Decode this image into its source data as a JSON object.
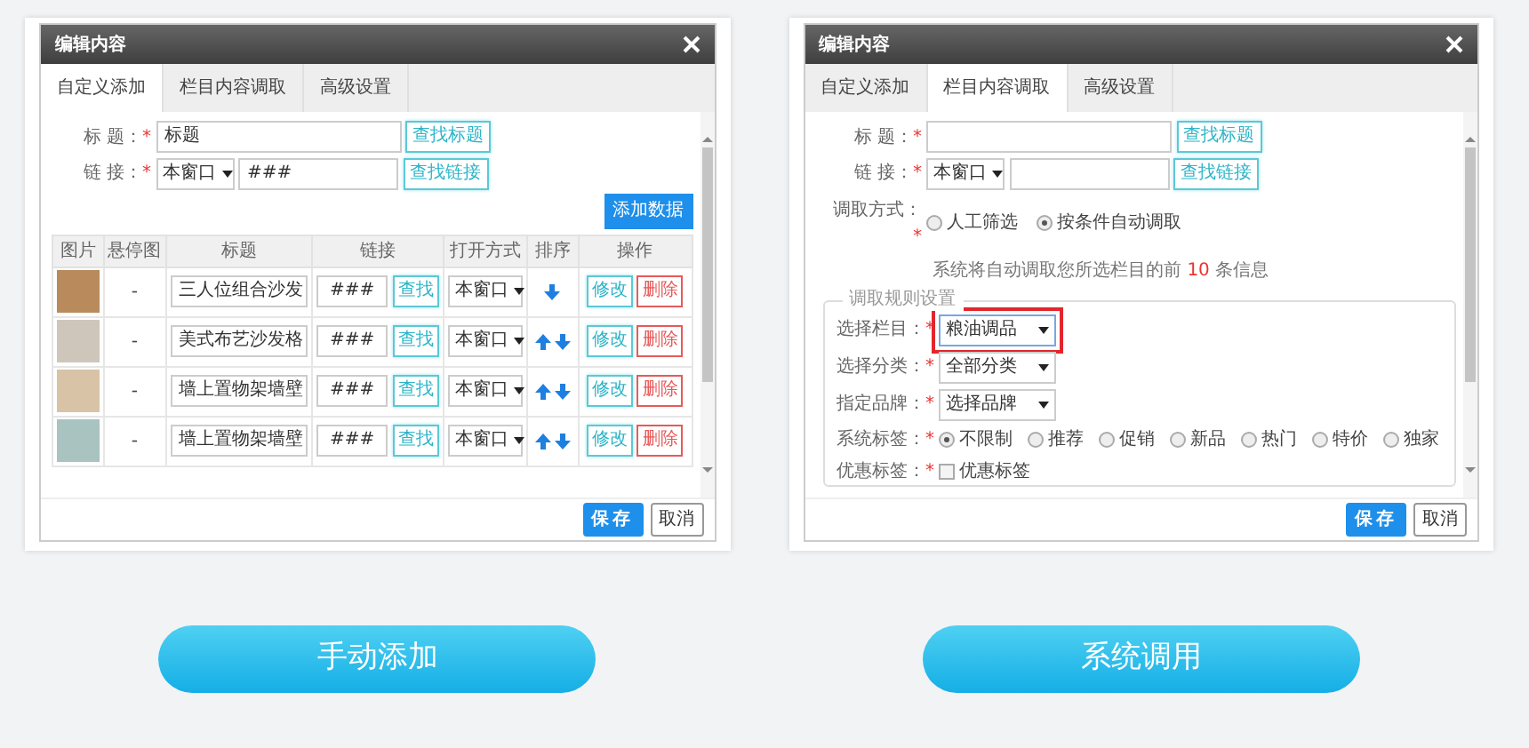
{
  "panels": [
    {
      "kind": "manual",
      "dialog": {
        "title": "编辑内容",
        "tabs": [
          {
            "label": "自定义添加",
            "selected": true
          },
          {
            "label": "栏目内容调取",
            "selected": false
          },
          {
            "label": "高级设置",
            "selected": false
          }
        ],
        "fields": [
          {
            "kind": "text",
            "label": "标 题：",
            "required": "*",
            "value": "标题",
            "button": "查找标题"
          },
          {
            "kind": "link",
            "label": "链 接：",
            "required": "*",
            "select": "本窗口",
            "value": "###",
            "button": "查找链接"
          }
        ],
        "add_button": "添加数据",
        "table": {
          "columns": [
            "图片",
            "悬停图",
            "标题",
            "链接",
            "打开方式",
            "排序",
            "操作"
          ],
          "rows": [
            {
              "hover": "-",
              "title": "三人位组合沙发",
              "link": "###",
              "find_button": "查找",
              "open": "本窗口",
              "up": false,
              "down": true,
              "edit": "修改",
              "delete": "删除"
            },
            {
              "hover": "-",
              "title": "美式布艺沙发格",
              "link": "###",
              "find_button": "查找",
              "open": "本窗口",
              "up": true,
              "down": true,
              "edit": "修改",
              "delete": "删除"
            },
            {
              "hover": "-",
              "title": "墙上置物架墙壁",
              "link": "###",
              "find_button": "查找",
              "open": "本窗口",
              "up": true,
              "down": true,
              "edit": "修改",
              "delete": "删除"
            },
            {
              "hover": "-",
              "title": "墙上置物架墙壁",
              "link": "###",
              "find_button": "查找",
              "open": "本窗口",
              "up": true,
              "down": true,
              "edit": "修改",
              "delete": "删除"
            }
          ]
        },
        "save": "保存",
        "cancel": "取消"
      },
      "caption": "手动添加"
    },
    {
      "kind": "system",
      "dialog": {
        "title": "编辑内容",
        "tabs": [
          {
            "label": "自定义添加",
            "selected": false
          },
          {
            "label": "栏目内容调取",
            "selected": true
          },
          {
            "label": "高级设置",
            "selected": false
          }
        ],
        "fields": [
          {
            "kind": "text",
            "label": "标 题：",
            "required": "*",
            "button": "查找标题"
          },
          {
            "kind": "link",
            "label": "链 接：",
            "required": "*",
            "select": "本窗口",
            "button": "查找链接"
          }
        ],
        "mode": {
          "label": "调取方式：",
          "required": "*",
          "options": [
            {
              "label": "人工筛选",
              "selected": false
            },
            {
              "label": "按条件自动调取",
              "selected": true
            }
          ]
        },
        "hint": {
          "before": "系统将自动调取您所选栏目的前",
          "count": "10",
          "after": "条信息"
        },
        "rules": {
          "legend": "调取规则设置",
          "selects": [
            {
              "label": "选择栏目：",
              "required": "*",
              "value": "粮油调品",
              "highlighted": true
            },
            {
              "label": "选择分类：",
              "required": "*",
              "value": "全部分类",
              "highlighted": false
            },
            {
              "label": "指定品牌：",
              "required": "*",
              "value": "选择品牌",
              "highlighted": false
            }
          ],
          "tags": {
            "label": "系统标签：",
            "required": "*",
            "options": [
              {
                "label": "不限制",
                "selected": true
              },
              {
                "label": "推荐",
                "selected": false
              },
              {
                "label": "促销",
                "selected": false
              },
              {
                "label": "新品",
                "selected": false
              },
              {
                "label": "热门",
                "selected": false
              },
              {
                "label": "特价",
                "selected": false
              },
              {
                "label": "独家",
                "selected": false
              }
            ]
          },
          "discount": {
            "label": "优惠标签：",
            "required": "*",
            "option": "优惠标签",
            "checked": false
          }
        },
        "save": "保存",
        "cancel": "取消"
      },
      "caption": "系统调用"
    }
  ]
}
